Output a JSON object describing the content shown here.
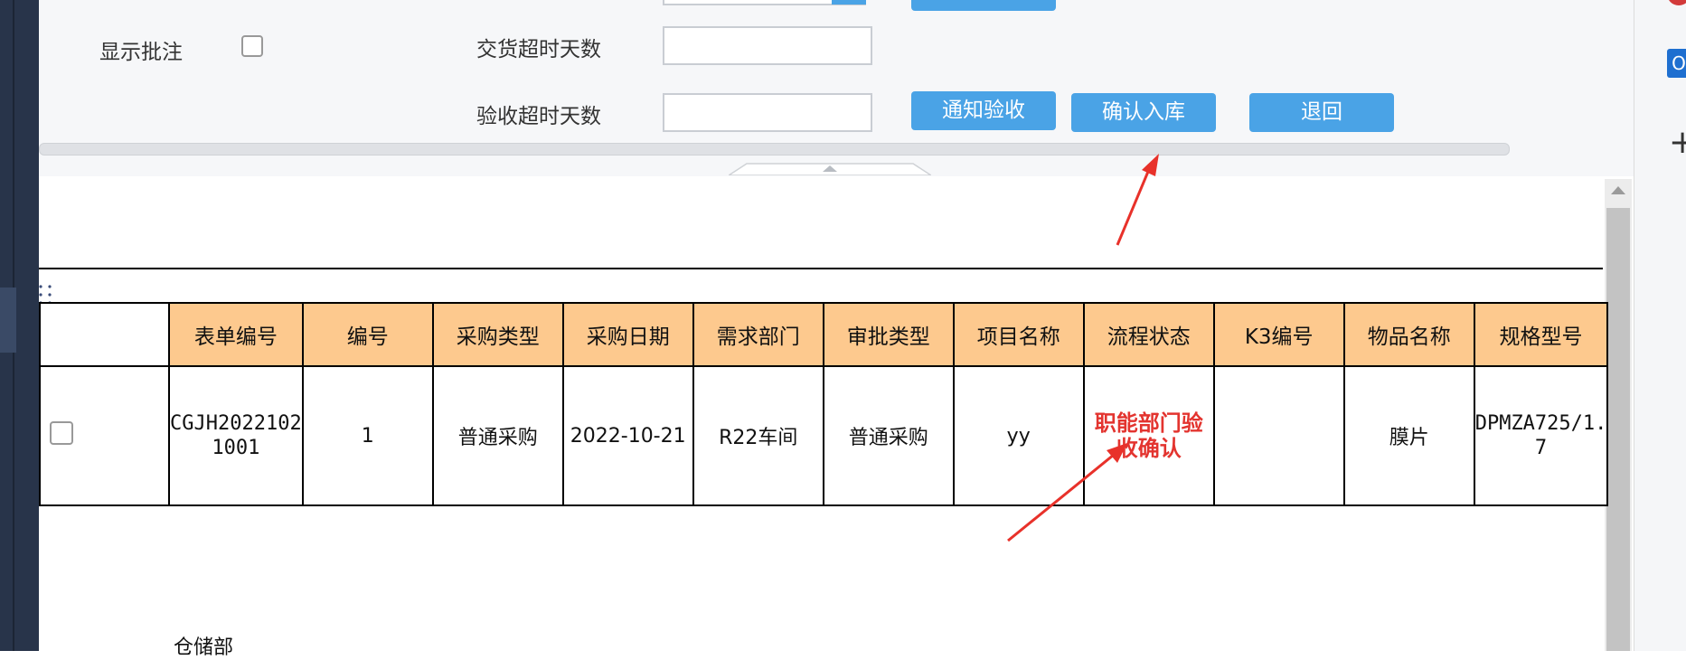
{
  "filter_panel": {
    "show_comments_label": "显示批注",
    "delivery_overdue_label": "交货超时天数",
    "delivery_overdue_value": "",
    "acceptance_overdue_label": "验收超时天数",
    "acceptance_overdue_value": "",
    "buttons": {
      "notify_acceptance": "通知验收",
      "confirm_inbound": "确认入库",
      "return": "退回"
    }
  },
  "table": {
    "columns": [
      "表单编号",
      "编号",
      "采购类型",
      "采购日期",
      "需求部门",
      "审批类型",
      "项目名称",
      "流程状态",
      "K3编号",
      "物品名称",
      "规格型号"
    ],
    "rows": [
      {
        "form_no": "CGJH2022102\n1001",
        "no": "1",
        "purchase_type": "普通采购",
        "purchase_date": "2022-10-21",
        "department": "R22车间",
        "approval_type": "普通采购",
        "project_name": "yy",
        "status": "职能部门验\n收确认",
        "k3_no": "",
        "item_name": "膜片",
        "spec": "DPMZA725/1.\n7"
      }
    ]
  },
  "bottom_label": "仓储部",
  "colors": {
    "header_bg": "#fdc98e",
    "button_bg": "#4aa3e6",
    "status_text": "#e3342f",
    "annotation_arrow": "#e8312a"
  },
  "icons": [
    "plus-icon",
    "outlook-icon",
    "collapse-arrow-icon",
    "scroll-up-arrow-icon"
  ]
}
